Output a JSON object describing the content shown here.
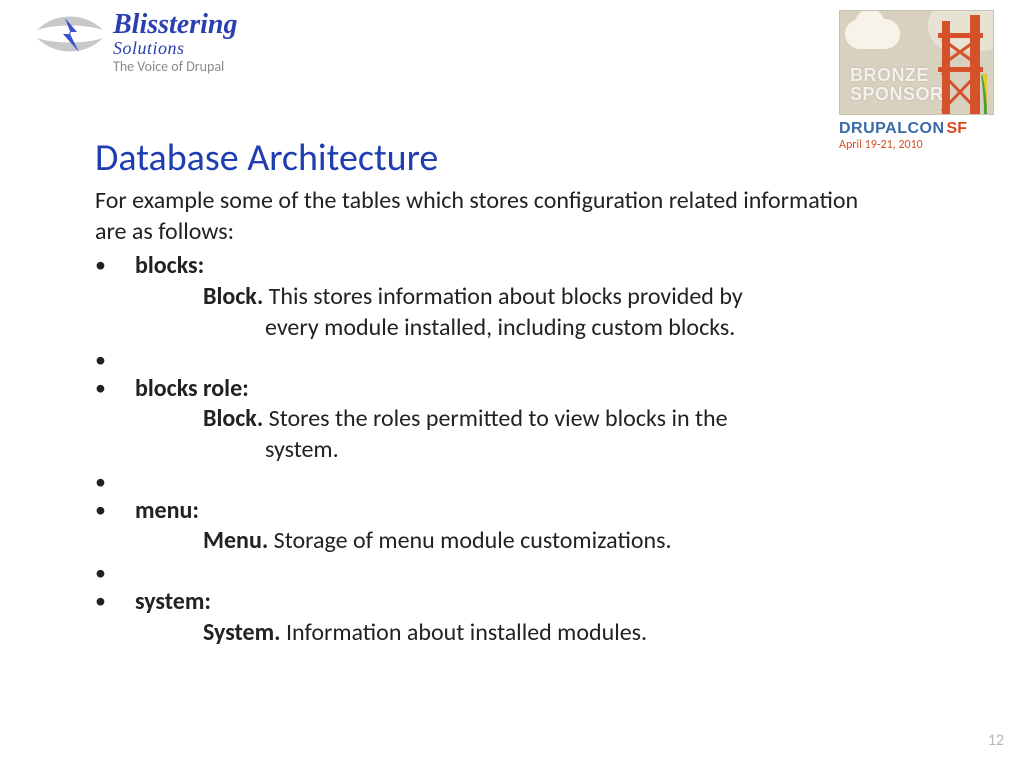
{
  "logo": {
    "title": "Blisstering",
    "sub": "Solutions",
    "tag": "The Voice of Drupal"
  },
  "sponsor": {
    "line1": "BRONZE",
    "line2": "SPONSOR"
  },
  "conference": {
    "name": "DRUPALCON",
    "city": "SF",
    "date": "April 19-21, 2010"
  },
  "title": "Database Architecture",
  "intro": "For example some of the tables which stores configuration related information are as follows:",
  "items": [
    {
      "label": "blocks:",
      "subject": "Block.",
      "desc_first": " This stores information about blocks provided by",
      "desc_cont": "every module installed, including custom blocks."
    },
    {
      "label": "blocks role:",
      "subject": "Block.",
      "desc_first": " Stores the roles permitted to view blocks in the",
      "desc_cont": "system."
    },
    {
      "label": "menu:",
      "subject": "Menu.",
      "desc_first": " Storage of menu module customizations.",
      "desc_cont": ""
    },
    {
      "label": "system:",
      "subject": "System.",
      "desc_first": " Information about installed modules.",
      "desc_cont": ""
    }
  ],
  "page_number": "12"
}
